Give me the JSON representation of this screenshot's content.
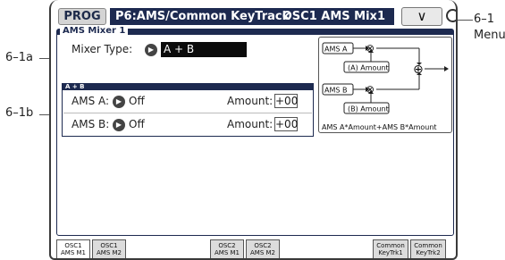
{
  "header": {
    "mode": "PROG",
    "page_title": "P6:AMS/Common KeyTrack",
    "page_tab": "OSC1 AMS Mix1",
    "menu_glyph": "∨"
  },
  "callouts": {
    "menu": "6–1",
    "menu_sub": "Menu",
    "mixer_type": "6–1a",
    "ams_rows": "6–1b"
  },
  "mixer": {
    "group_label": "AMS Mixer 1",
    "mixer_type_label": "Mixer Type:",
    "mixer_type_value": "A + B",
    "subgroup_label": "A + B",
    "rows": [
      {
        "label": "AMS A:",
        "value": "Off",
        "amount_label": "Amount:",
        "amount_value": "+00"
      },
      {
        "label": "AMS B:",
        "value": "Off",
        "amount_label": "Amount:",
        "amount_value": "+00"
      }
    ]
  },
  "diagram": {
    "ams_a": "AMS A",
    "ams_b": "AMS B",
    "a_amount": "(A) Amount",
    "b_amount": "(B) Amount",
    "multiply": "⊗",
    "plus": "⊕",
    "formula": "AMS A*Amount+AMS B*Amount"
  },
  "tabs": [
    {
      "line1": "OSC1",
      "line2": "AMS M1",
      "active": true
    },
    {
      "line1": "OSC1",
      "line2": "AMS M2",
      "active": false
    },
    {
      "line1": "OSC2",
      "line2": "AMS M1",
      "active": false
    },
    {
      "line1": "OSC2",
      "line2": "AMS M2",
      "active": false
    },
    {
      "line1": "Common",
      "line2": "KeyTrk1",
      "active": false
    },
    {
      "line1": "Common",
      "line2": "KeyTrk2",
      "active": false
    }
  ]
}
